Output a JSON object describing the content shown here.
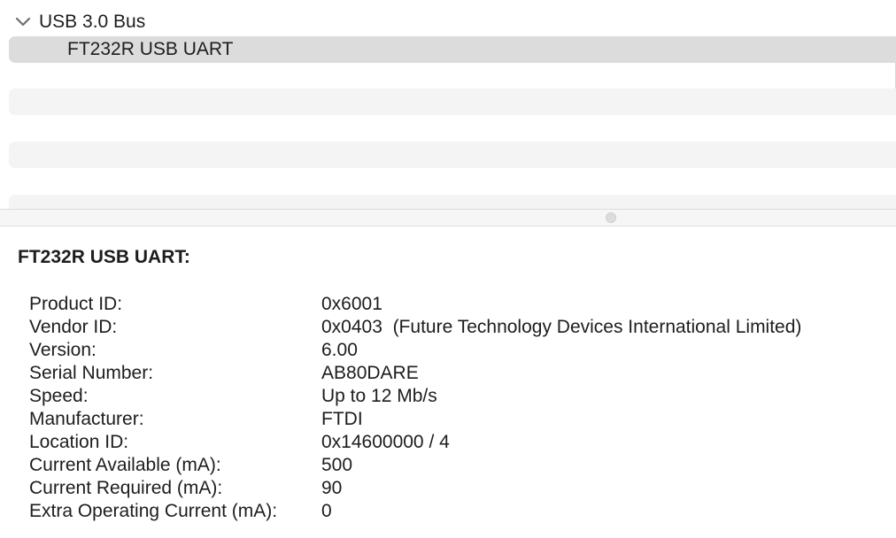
{
  "tree": {
    "bus_label": "USB 3.0 Bus",
    "device_label": "FT232R USB UART"
  },
  "detail": {
    "title": "FT232R USB UART:",
    "properties": [
      {
        "key": "Product ID:",
        "value": "0x6001"
      },
      {
        "key": "Vendor ID:",
        "value": "0x0403  (Future Technology Devices International Limited)"
      },
      {
        "key": "Version:",
        "value": "6.00"
      },
      {
        "key": "Serial Number:",
        "value": "AB80DARE"
      },
      {
        "key": "Speed:",
        "value": "Up to 12 Mb/s"
      },
      {
        "key": "Manufacturer:",
        "value": "FTDI"
      },
      {
        "key": "Location ID:",
        "value": "0x14600000 / 4"
      },
      {
        "key": "Current Available (mA):",
        "value": "500"
      },
      {
        "key": "Current Required (mA):",
        "value": "90"
      },
      {
        "key": "Extra Operating Current (mA):",
        "value": "0"
      }
    ]
  },
  "icons": {
    "expand": "chevron-down-icon"
  },
  "colors": {
    "selected_row": "#dcdcdc",
    "stripe_row": "#f4f4f4",
    "text": "#1d1d1f"
  }
}
